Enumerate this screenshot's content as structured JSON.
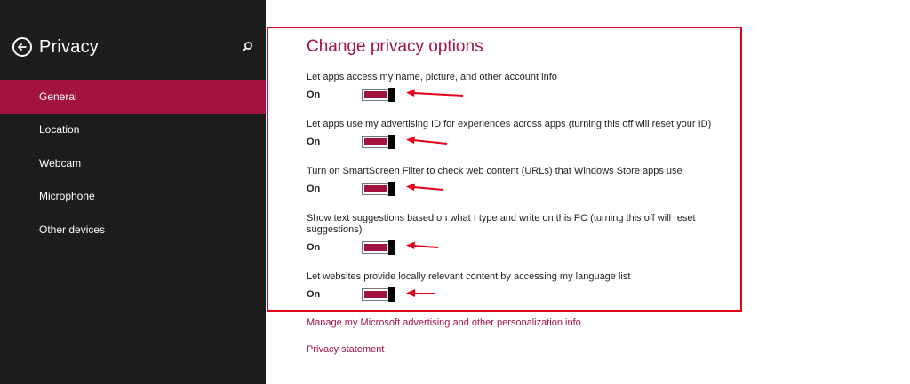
{
  "sidebar": {
    "title": "Privacy",
    "items": [
      {
        "label": "General",
        "selected": true
      },
      {
        "label": "Location",
        "selected": false
      },
      {
        "label": "Webcam",
        "selected": false
      },
      {
        "label": "Microphone",
        "selected": false
      },
      {
        "label": "Other devices",
        "selected": false
      }
    ]
  },
  "main": {
    "title": "Change privacy options",
    "settings": [
      {
        "description": "Let apps access my name, picture, and other account info",
        "state": "On"
      },
      {
        "description": "Let apps use my advertising ID for experiences across apps (turning this off will reset your ID)",
        "state": "On"
      },
      {
        "description": "Turn on SmartScreen Filter to check web content (URLs) that Windows Store apps use",
        "state": "On"
      },
      {
        "description": "Show text suggestions based on what I type and write on this PC (turning this off will reset suggestions)",
        "state": "On"
      },
      {
        "description": "Let websites provide locally relevant content by accessing my language list",
        "state": "On"
      }
    ],
    "links": {
      "manage": "Manage my Microsoft advertising and other personalization info",
      "privacy_statement": "Privacy statement"
    }
  },
  "icons": {
    "back": "back-arrow-icon",
    "search": "search-icon",
    "annotation": "red-arrow-icon"
  },
  "colors": {
    "sidebar_bg": "#1d1d1d",
    "accent": "#a2133f",
    "annotation_red": "#e3001b"
  }
}
